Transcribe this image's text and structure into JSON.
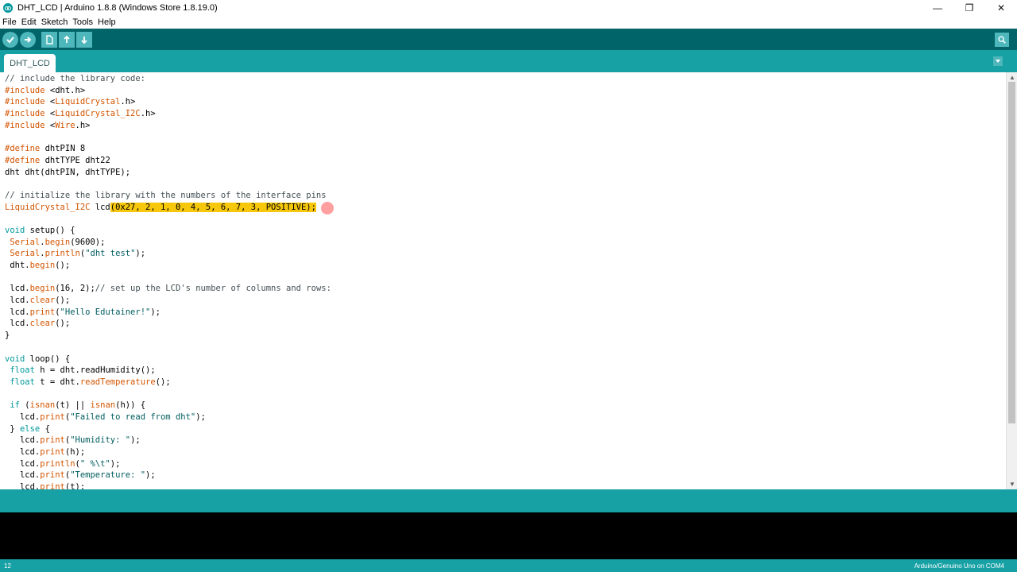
{
  "window": {
    "title": "DHT_LCD | Arduino 1.8.8 (Windows Store 1.8.19.0)",
    "controls": {
      "minimize": "—",
      "maximize": "❐",
      "close": "✕"
    }
  },
  "menu": [
    "File",
    "Edit",
    "Sketch",
    "Tools",
    "Help"
  ],
  "toolbar": {
    "buttons": [
      "verify-icon",
      "upload-icon",
      "new-icon",
      "open-icon",
      "save-icon"
    ],
    "serial_monitor": "serial-monitor-icon"
  },
  "tabs": [
    {
      "label": "DHT_LCD"
    }
  ],
  "editor": {
    "lines": [
      "// include the library code:",
      "#include <dht.h>",
      "#include <LiquidCrystal.h>",
      "#include <LiquidCrystal_I2C.h>",
      "#include <Wire.h>",
      "",
      "#define dhtPIN 8",
      "#define dhtTYPE dht22",
      "dht dht(dhtPIN, dhtTYPE);",
      "",
      "// initialize the library with the numbers of the interface pins",
      "LiquidCrystal_I2C lcd(0x27, 2, 1, 0, 4, 5, 6, 7, 3, POSITIVE);",
      "",
      "void setup() {",
      " Serial.begin(9600);",
      " Serial.println(\"dht test\");",
      " dht.begin();",
      "",
      " lcd.begin(16, 2);// set up the LCD's number of columns and rows:",
      " lcd.clear();",
      " lcd.print(\"Hello Edutainer!\");",
      " lcd.clear();",
      "}",
      "",
      "void loop() {",
      " float h = dht.readHumidity();",
      " float t = dht.readTemperature();",
      "",
      " if (isnan(t) || isnan(h)) {",
      "   lcd.print(\"Failed to read from dht\");",
      " } else {",
      "   lcd.print(\"Humidity: \");",
      "   lcd.print(h);",
      "   lcd.println(\" %\\t\");",
      "   lcd.print(\"Temperature: \");",
      "   lcd.print(t);"
    ],
    "highlighted_line": 11
  },
  "status": {
    "line_number": "12",
    "board": "Arduino/Genuino Uno on COM4"
  },
  "colors": {
    "toolbar": "#006468",
    "tabs": "#17a1a5",
    "highlight": "#f6c70b"
  }
}
